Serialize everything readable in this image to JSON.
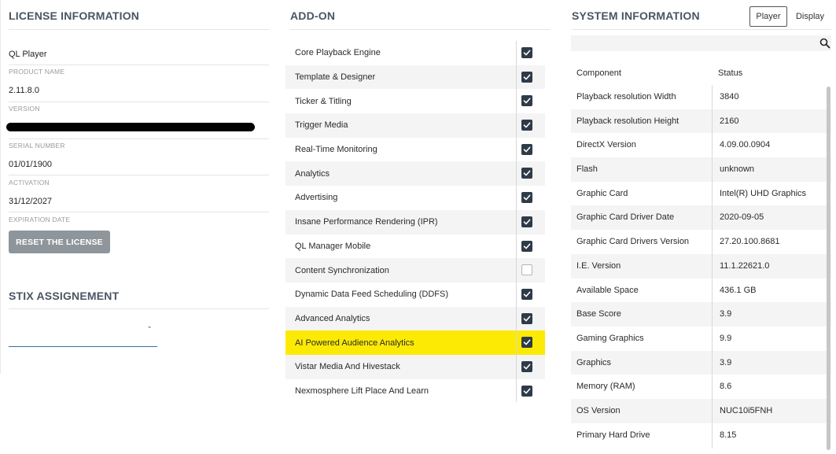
{
  "license": {
    "title": "LICENSE INFORMATION",
    "product_name_value": "QL Player",
    "product_name_label": "PRODUCT NAME",
    "version_value": "2.11.8.0",
    "version_label": "VERSION",
    "serial_label": "SERIAL NUMBER",
    "activation_value": "01/01/1900",
    "activation_label": "ACTIVATION",
    "expiration_value": "31/12/2027",
    "expiration_label": "EXPIRATION DATE",
    "reset_button": "RESET THE LICENSE"
  },
  "stix": {
    "title": "STIX ASSIGNEMENT",
    "chevron": "ˇ"
  },
  "addon": {
    "title": "ADD-ON",
    "items": [
      {
        "label": "Core Playback Engine",
        "checked": true
      },
      {
        "label": "Template & Designer",
        "checked": true
      },
      {
        "label": "Ticker & Titling",
        "checked": true
      },
      {
        "label": "Trigger Media",
        "checked": true
      },
      {
        "label": "Real-Time Monitoring",
        "checked": true
      },
      {
        "label": "Analytics",
        "checked": true
      },
      {
        "label": "Advertising",
        "checked": true
      },
      {
        "label": "Insane Performance Rendering (IPR)",
        "checked": true
      },
      {
        "label": "QL Manager Mobile",
        "checked": true
      },
      {
        "label": "Content Synchronization",
        "checked": false
      },
      {
        "label": "Dynamic Data Feed Scheduling (DDFS)",
        "checked": true
      },
      {
        "label": "Advanced Analytics",
        "checked": true
      },
      {
        "label": "AI Powered Audience Analytics",
        "checked": true,
        "highlighted": true
      },
      {
        "label": "Vistar Media And Hivestack",
        "checked": true
      },
      {
        "label": "Nexmosphere Lift Place And Learn",
        "checked": true
      }
    ]
  },
  "system": {
    "title": "SYSTEM INFORMATION",
    "tabs": [
      {
        "label": "Player",
        "active": true
      },
      {
        "label": "Display",
        "active": false
      }
    ],
    "columns": {
      "component": "Component",
      "status": "Status"
    },
    "rows": [
      {
        "component": "Playback resolution Width",
        "status": "3840"
      },
      {
        "component": "Playback resolution Height",
        "status": "2160"
      },
      {
        "component": "DirectX Version",
        "status": "4.09.00.0904"
      },
      {
        "component": "Flash",
        "status": "unknown"
      },
      {
        "component": "Graphic Card",
        "status": "Intel(R) UHD Graphics"
      },
      {
        "component": "Graphic Card Driver Date",
        "status": "2020-09-05"
      },
      {
        "component": "Graphic Card Drivers Version",
        "status": "27.20.100.8681"
      },
      {
        "component": "I.E. Version",
        "status": "11.1.22621.0"
      },
      {
        "component": "Available Space",
        "status": "436.1 GB"
      },
      {
        "component": "Base Score",
        "status": "3.9"
      },
      {
        "component": "Gaming Graphics",
        "status": "9.9"
      },
      {
        "component": "Graphics",
        "status": "3.9"
      },
      {
        "component": "Memory (RAM)",
        "status": "8.6"
      },
      {
        "component": "OS Version",
        "status": "NUC10i5FNH"
      },
      {
        "component": "Primary Hard Drive",
        "status": "8.15"
      }
    ]
  },
  "colors": {
    "checkbox_on": "#2f3b48",
    "highlight": "#fcea05",
    "reset_button_bg": "#8e969c",
    "section_title": "#4a5563"
  }
}
